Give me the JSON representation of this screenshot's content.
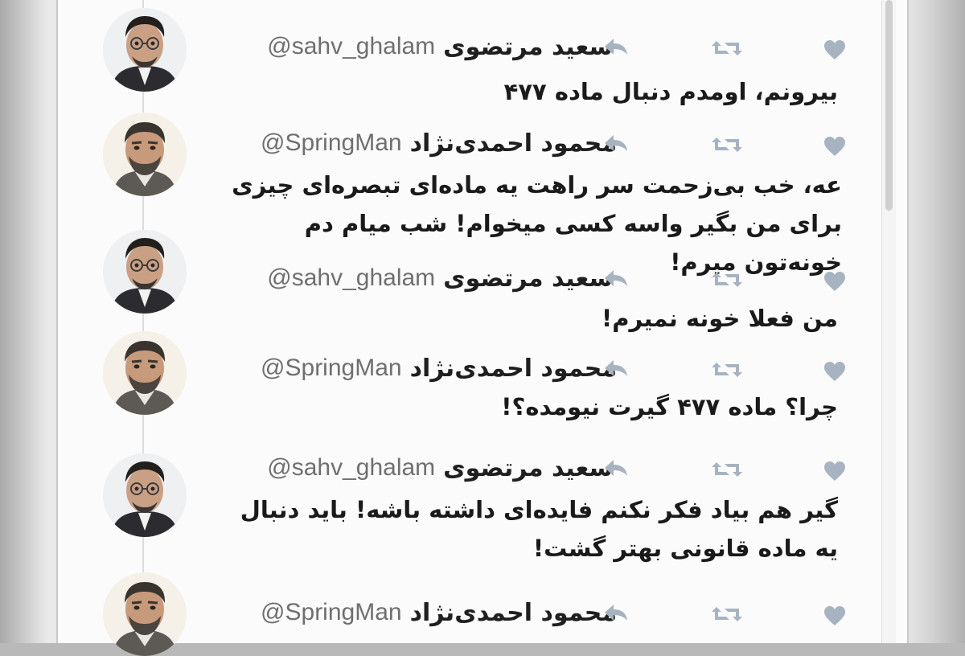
{
  "theme": {
    "screen_bg": "#fbfbfb",
    "text_color": "#1a1a1a",
    "handle_color": "#6f6f6f",
    "icon_color": "#a7b3c0"
  },
  "icons": {
    "reply": "reply-arrow-icon",
    "retweet": "retweet-icon",
    "like": "heart-icon"
  },
  "tweets": [
    {
      "name": "سعید مرتضوی",
      "handle": "@sahv_ghalam",
      "avatar": "mortazavi",
      "text": "بیرونم، اومدم دنبال ماده ۴۷۷"
    },
    {
      "name": "محمود احمدی‌نژاد",
      "handle": "@SpringMan",
      "avatar": "ahmadinejad",
      "text": "عه، خب بی‌زحمت سر راهت یه ماده‌ای تبصره‌ای چیزی برای من بگیر واسه کسی میخوام! شب میام دم خونه‌تون میرم!"
    },
    {
      "name": "سعید مرتضوی",
      "handle": "@sahv_ghalam",
      "avatar": "mortazavi",
      "text": "من فعلا خونه نمیرم!"
    },
    {
      "name": "محمود احمدی‌نژاد",
      "handle": "@SpringMan",
      "avatar": "ahmadinejad",
      "text": "چرا؟ ماده ۴۷۷ گیرت نیومده؟!"
    },
    {
      "name": "سعید مرتضوی",
      "handle": "@sahv_ghalam",
      "avatar": "mortazavi",
      "text": "گیر هم بیاد فکر نکنم فایده‌ای داشته باشه! باید دنبال یه ماده قانونی بهتر گشت!"
    },
    {
      "name": "محمود احمدی‌نژاد",
      "handle": "@SpringMan",
      "avatar": "ahmadinejad",
      "text": ""
    }
  ]
}
